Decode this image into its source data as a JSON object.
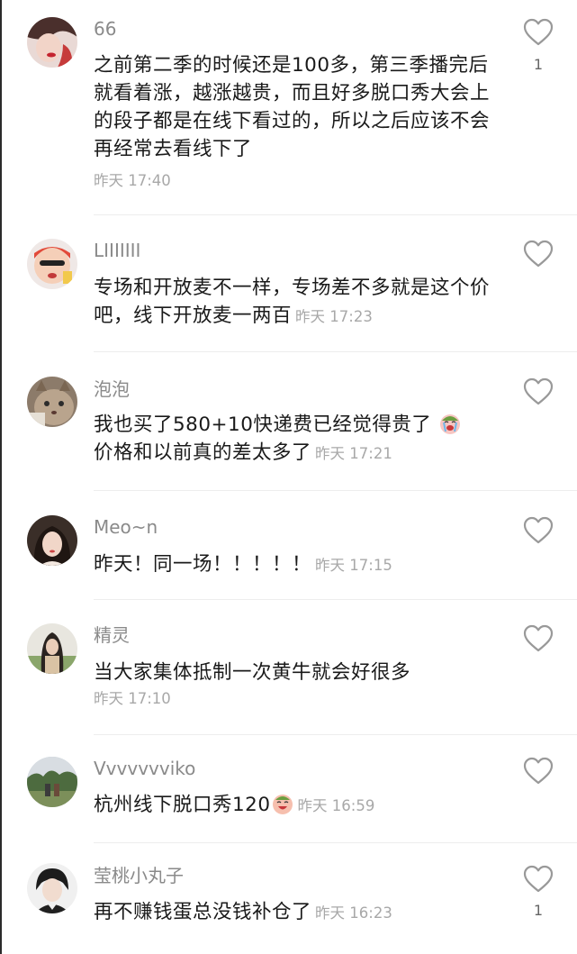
{
  "comments": [
    {
      "username": "66",
      "text": "之前第二季的时候还是100多，第三季播完后就看着涨，越涨越贵，而且好多脱口秀大会上的段子都是在线下看过的，所以之后应该不会再经常去看线下了",
      "time": "昨天 17:40",
      "likes": "1",
      "avatar_icon": "avatar-woman-red-lips"
    },
    {
      "username": "LIIIIIII",
      "text": "专场和开放麦不一样，专场差不多就是这个价吧，线下开放麦一两百",
      "time": "昨天 17:23",
      "likes": "",
      "avatar_icon": "avatar-cartoon-character"
    },
    {
      "username": "泡泡",
      "text": "我也买了580+10快递费已经觉得贵了",
      "text2": "价格和以前真的差太多了",
      "time": "昨天 17:21",
      "likes": "",
      "avatar_icon": "avatar-cat",
      "emoji": "crying-face-emoji"
    },
    {
      "username": "Meo~n",
      "text": "昨天！同一场！！！！！",
      "time": "昨天 17:15",
      "likes": "",
      "avatar_icon": "avatar-woman-portrait"
    },
    {
      "username": "精灵",
      "text": "当大家集体抵制一次黄牛就会好很多",
      "time": "昨天 17:10",
      "likes": "",
      "avatar_icon": "avatar-girl-outdoor"
    },
    {
      "username": "Vvvvvvviko",
      "text": "杭州线下脱口秀120",
      "time": "昨天 16:59",
      "likes": "",
      "avatar_icon": "avatar-landscape",
      "emoji": "laughing-face-emoji"
    },
    {
      "username": "莹桃小丸子",
      "text": "再不赚钱蛋总没钱补仓了",
      "time": "昨天 16:23",
      "likes": "1",
      "avatar_icon": "avatar-man-portrait"
    }
  ],
  "colors": {
    "username": "#8a8a8a",
    "text": "#1a1a1a",
    "time": "#a8a8a8",
    "heart": "#999999"
  },
  "icons": {
    "like": "heart-outline-icon"
  }
}
